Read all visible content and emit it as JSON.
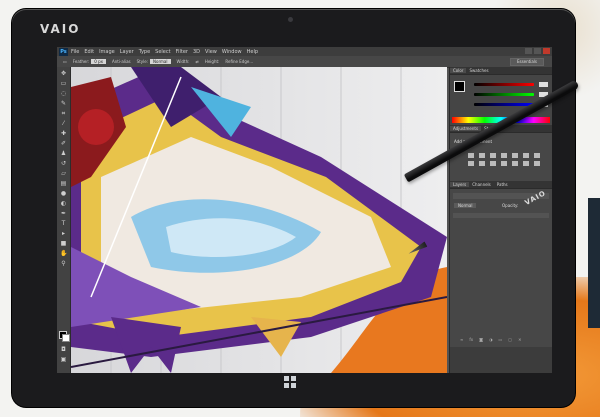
{
  "device": {
    "brand": "VAIO"
  },
  "app": {
    "icon": "Ps",
    "menu": [
      "File",
      "Edit",
      "Image",
      "Layer",
      "Type",
      "Select",
      "Filter",
      "3D",
      "View",
      "Window",
      "Help"
    ]
  },
  "options_bar": {
    "feather_label": "Feather:",
    "feather_value": "0 px",
    "antialias_label": "Anti-alias",
    "style_label": "Style:",
    "style_value": "Normal",
    "width_label": "Width:",
    "height_label": "Height:",
    "refine_label": "Refine Edge...",
    "workspace": "Essentials"
  },
  "panels": {
    "color_tabs": [
      "Color",
      "Swatches"
    ],
    "adjust_tabs": [
      "Adjustments",
      "Styles"
    ],
    "adjust_title": "Add an adjustment",
    "layers_tabs": [
      "Layers",
      "Channels",
      "Paths"
    ],
    "blend_mode": "Normal",
    "opacity_label": "Opacity:"
  },
  "pen": {
    "brand": "VAIO"
  }
}
